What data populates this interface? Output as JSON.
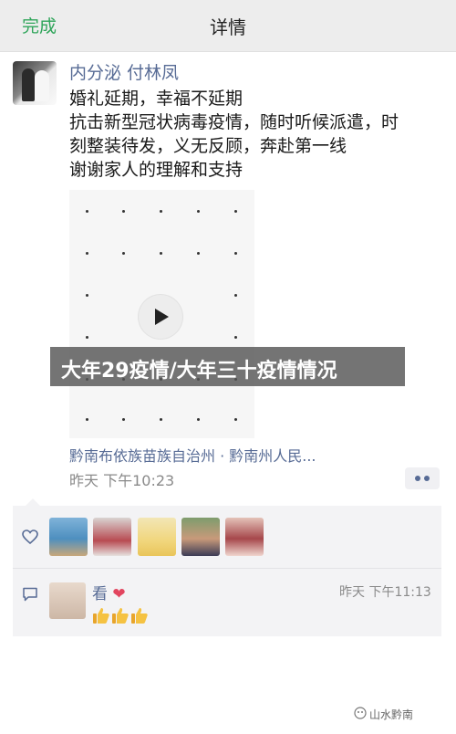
{
  "header": {
    "done_label": "完成",
    "title": "详情"
  },
  "post": {
    "author": "内分泌 付林凤",
    "lines": [
      "婚礼延期，幸福不延期",
      "抗击新型冠状病毒疫情，随时听候派遣，时",
      "刻整装待发，义无反顾，奔赴第一线",
      "谢谢家人的理解和支持"
    ],
    "location": "黔南布依族苗族自治州 · 黔南州人民...",
    "time": "昨天 下午10:23"
  },
  "banner": {
    "text": "大年29疫情/大年三十疫情情况"
  },
  "likes": {
    "count_avatars": 5
  },
  "comment": {
    "name": "看",
    "time": "昨天 下午11:13",
    "thumbs": 3
  },
  "watermark": {
    "text": "山水黔南"
  },
  "colors": {
    "accent_green": "#2fa55a",
    "link_blue": "#576b95",
    "panel_bg": "#f3f3f5"
  }
}
